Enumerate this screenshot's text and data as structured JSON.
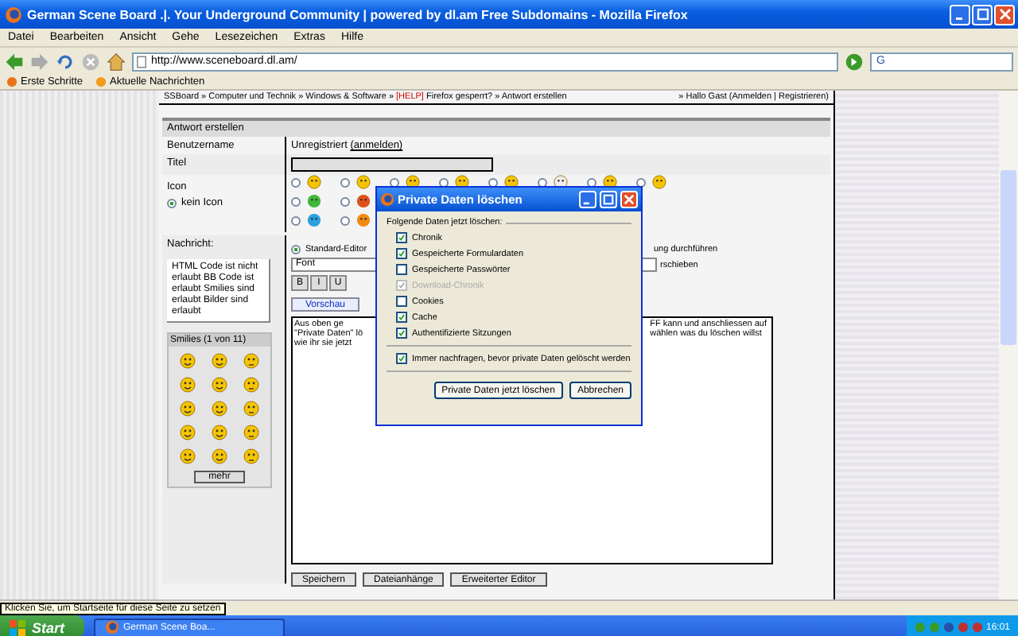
{
  "window": {
    "title": "German Scene Board .|. Your Underground Community | powered by dl.am Free Subdomains - Mozilla Firefox"
  },
  "menu": [
    "Datei",
    "Bearbeiten",
    "Ansicht",
    "Gehe",
    "Lesezeichen",
    "Extras",
    "Hilfe"
  ],
  "address": {
    "value": "http://www.sceneboard.dl.am/"
  },
  "search": {
    "value": "G"
  },
  "bookmarks": [
    "Erste Schritte",
    "Aktuelle Nachrichten"
  ],
  "breadcrumb": {
    "path": "SSBoard » Computer und Technik » Windows & Software » ",
    "tag": "[HELP]",
    "rest": " Firefox gesperrt? » Antwort erstellen",
    "user": "» Hallo Gast (Anmelden | Registrieren)"
  },
  "form": {
    "title": "Antwort erstellen",
    "username_label": "Benutzername",
    "username_value": "Unregistriert",
    "login_link": "(anmelden)",
    "title_label": "Titel",
    "icon_label": "Icon",
    "no_icon": {
      "label": "kein Icon",
      "selected": true
    },
    "icon_choices": [
      {
        "selected": false
      },
      {
        "selected": false
      },
      {
        "selected": false
      },
      {
        "selected": false
      },
      {
        "selected": false
      },
      {
        "selected": false
      },
      {
        "selected": false
      },
      {
        "selected": false
      },
      {
        "selected": false
      },
      {
        "selected": false
      },
      {
        "selected": false
      },
      {
        "selected": false
      }
    ],
    "message_label": "Nachricht:",
    "rules": "HTML Code ist nicht erlaubt BB Code ist erlaubt Smilies sind erlaubt Bilder sind erlaubt",
    "smilies_title": "Smilies (1 von 11)",
    "more_button": "mehr",
    "editor_option": {
      "label": "Standard-Editor",
      "selected": true
    },
    "right_option_1": "ung durchführen",
    "right_option_2": "rschieben",
    "font_select": "Font",
    "format_buttons": [
      "B",
      "I",
      "U"
    ],
    "preview_button": "Vorschau",
    "message_left": [
      "Aus oben ge",
      "\"Private Daten\" lö",
      "wie ihr sie jetzt"
    ],
    "message_right": [
      "FF kann und anschliessen auf",
      "wählen was du löschen willst"
    ],
    "buttons": [
      "Speichern",
      "Dateianhänge",
      "Erweiterter Editor"
    ]
  },
  "dialog": {
    "title": "Private Daten löschen",
    "group": "Folgende Daten jetzt löschen:",
    "items": [
      {
        "label": "Chronik",
        "checked": true,
        "disabled": false
      },
      {
        "label": "Gespeicherte Formulardaten",
        "checked": true,
        "disabled": false
      },
      {
        "label": "Gespeicherte Passwörter",
        "checked": false,
        "disabled": false
      },
      {
        "label": "Download-Chronik",
        "checked": true,
        "disabled": true
      },
      {
        "label": "Cookies",
        "checked": false,
        "disabled": false
      },
      {
        "label": "Cache",
        "checked": true,
        "disabled": false
      },
      {
        "label": "Authentifizierte Sitzungen",
        "checked": true,
        "disabled": false
      }
    ],
    "ask": {
      "label": "Immer nachfragen, bevor private Daten gelöscht werden",
      "checked": true
    },
    "buttons": [
      "Private Daten jetzt löschen",
      "Abbrechen"
    ]
  },
  "status_tooltip": "Klicken Sie, um Startseite für diese Seite zu setzen",
  "taskbar": {
    "start": "Start",
    "tasks": [
      "German Scene Boa..."
    ],
    "clock": "16:01"
  }
}
